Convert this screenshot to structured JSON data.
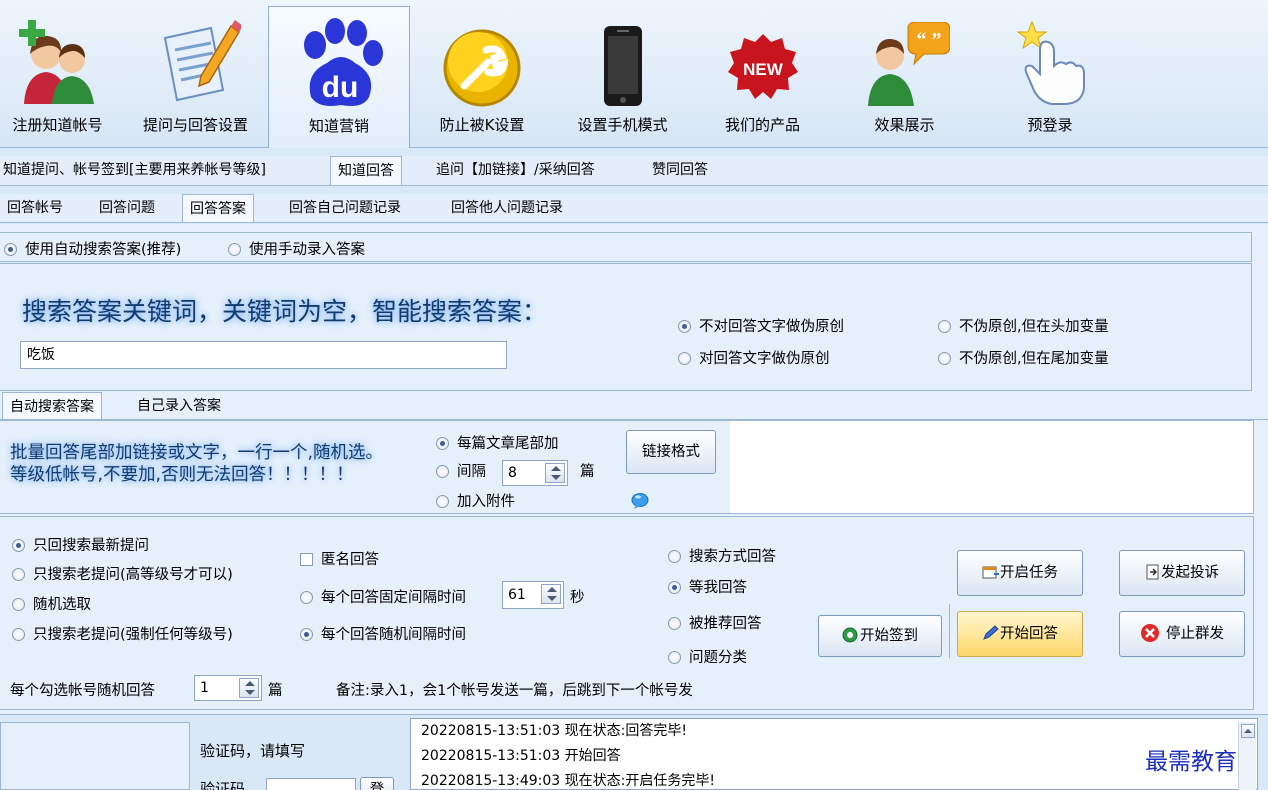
{
  "toolbar": {
    "buttons": [
      {
        "label": "注册知道帐号",
        "icon": "users-add-icon"
      },
      {
        "label": "提问与回答设置",
        "icon": "document-pencil-icon"
      },
      {
        "label": "知道营销",
        "icon": "baidu-paw-icon"
      },
      {
        "label": "防止被K设置",
        "icon": "wrench-icon"
      },
      {
        "label": "设置手机模式",
        "icon": "smartphone-icon"
      },
      {
        "label": "我们的产品",
        "icon": "new-badge-icon"
      },
      {
        "label": "效果展示",
        "icon": "user-speech-icon"
      },
      {
        "label": "预登录",
        "icon": "hand-pointer-icon"
      }
    ],
    "active_index": 2
  },
  "tabs_level1": [
    "知道提问、帐号签到[主要用来养帐号等级]",
    "知道回答",
    "追问【加链接】/采纳回答",
    "赞同回答"
  ],
  "tabs_level2": [
    "回答帐号",
    "回答问题",
    "回答答案",
    "回答自己问题记录",
    "回答他人问题记录"
  ],
  "answer_source": {
    "auto_label": "使用自动搜索答案(推荐)",
    "manual_label": "使用手动录入答案",
    "selected": "auto"
  },
  "search": {
    "heading": "搜索答案关键词，关键词为空，智能搜索答案：",
    "keyword_value": "吃饭"
  },
  "pseudo_original": {
    "options": [
      "不对回答文字做伪原创",
      "不伪原创,但在头加变量",
      "对回答文字做伪原创",
      "不伪原创,但在尾加变量"
    ],
    "selected_index": 0
  },
  "tabs_level3": [
    "自动搜索答案",
    "自己录入答案"
  ],
  "links": {
    "note_line1": "批量回答尾部加链接或文字，一行一个,随机选。",
    "note_line2": "等级低帐号,不要加,否则无法回答！！！！！",
    "opt_each_article": "每篇文章尾部加",
    "opt_interval": "间隔",
    "interval_value": "8",
    "interval_unit": "篇",
    "opt_attachment": "加入附件",
    "selected": "each",
    "format_button": "链接格式"
  },
  "question_filter": {
    "options": [
      "只回搜索最新提问",
      "只搜索老提问(高等级号才可以)",
      "随机选取",
      "只搜索老提问(强制任何等级号)"
    ],
    "selected_index": 0
  },
  "timing": {
    "anonymous_label": "匿名回答",
    "fixed_label": "每个回答固定间隔时间",
    "fixed_value": "61",
    "fixed_unit": "秒",
    "random_label": "每个回答随机间隔时间",
    "selected": "random"
  },
  "answer_mode": {
    "options": [
      "搜索方式回答",
      "等我回答",
      "被推荐回答",
      "问题分类"
    ],
    "selected_index": 1
  },
  "actions": {
    "start_signin": "开始签到",
    "start_task": "开启任务",
    "start_answer": "开始回答",
    "submit_complaint": "发起投诉",
    "stop_broadcast": "停止群发"
  },
  "per_account": {
    "label": "每个勾选帐号随机回答",
    "value": "1",
    "unit": "篇",
    "remark": "备注:录入1，会1个帐号发送一篇，后跳到下一个帐号发"
  },
  "captcha": {
    "prompt": "验证码，请填写",
    "label": "验证码",
    "button": "登"
  },
  "log": [
    "20220815-13:51:03 现在状态:回答完毕!",
    "20220815-13:51:03 开始回答",
    "20220815-13:49:03 现在状态:开启任务完毕!"
  ],
  "watermark": "最需教育",
  "colors": {
    "accent_blue": "#113a6f",
    "panel_bg": "#e6f0fb",
    "highlight_yellow": "#ffd76a"
  }
}
